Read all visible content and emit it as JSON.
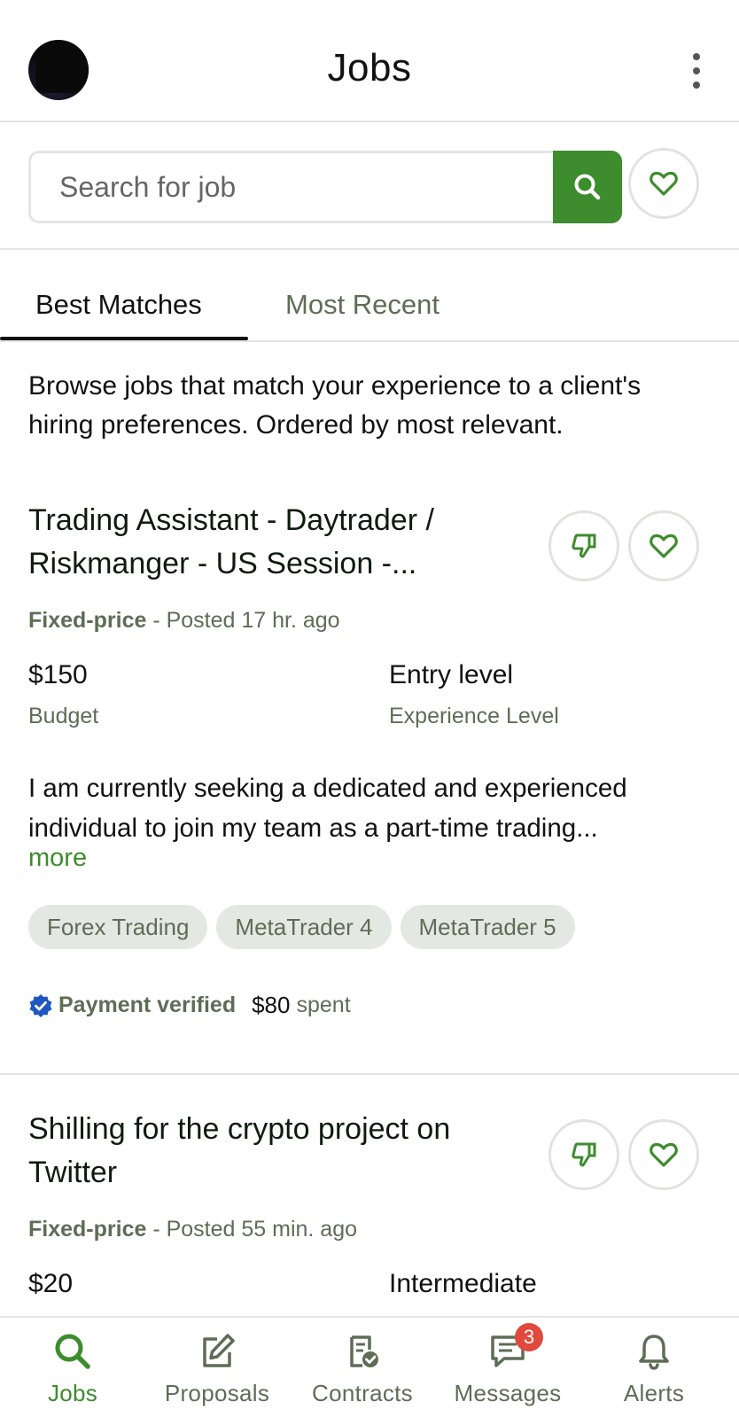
{
  "header": {
    "title": "Jobs"
  },
  "search": {
    "placeholder": "Search for job"
  },
  "tabs": [
    {
      "label": "Best Matches",
      "active": true
    },
    {
      "label": "Most Recent",
      "active": false
    }
  ],
  "intro": "Browse jobs that match your experience to a client's hiring preferences. Ordered by most relevant.",
  "jobs": [
    {
      "title": "Trading Assistant - Daytrader / Riskmanger - US Session -...",
      "pricing_type": "Fixed-price",
      "posted": " - Posted 17 hr. ago",
      "budget": "$150",
      "budget_label": "Budget",
      "experience": "Entry level",
      "experience_label": "Experience Level",
      "description": "I am currently seeking a dedicated and experienced individual to join my team as a part-time trading...",
      "more": "more",
      "skills": [
        "Forex Trading",
        "MetaTrader 4",
        "MetaTrader 5"
      ],
      "payment": "Payment verified",
      "spent_amount": "$80",
      "spent_label": "spent"
    },
    {
      "title": "Shilling for the crypto project on Twitter",
      "pricing_type": "Fixed-price",
      "posted": " - Posted 55 min. ago",
      "budget": "$20",
      "experience": "Intermediate"
    }
  ],
  "bottom_nav": [
    {
      "label": "Jobs",
      "icon": "search-icon",
      "active": true
    },
    {
      "label": "Proposals",
      "icon": "edit-icon",
      "active": false
    },
    {
      "label": "Contracts",
      "icon": "contract-icon",
      "active": false
    },
    {
      "label": "Messages",
      "icon": "message-icon",
      "active": false,
      "badge": "3"
    },
    {
      "label": "Alerts",
      "icon": "bell-icon",
      "active": false
    }
  ],
  "colors": {
    "brand_green": "#3d8c2d",
    "muted_text": "#5e6d55",
    "badge_red": "#e0493b",
    "verified_blue": "#1f57c3"
  }
}
